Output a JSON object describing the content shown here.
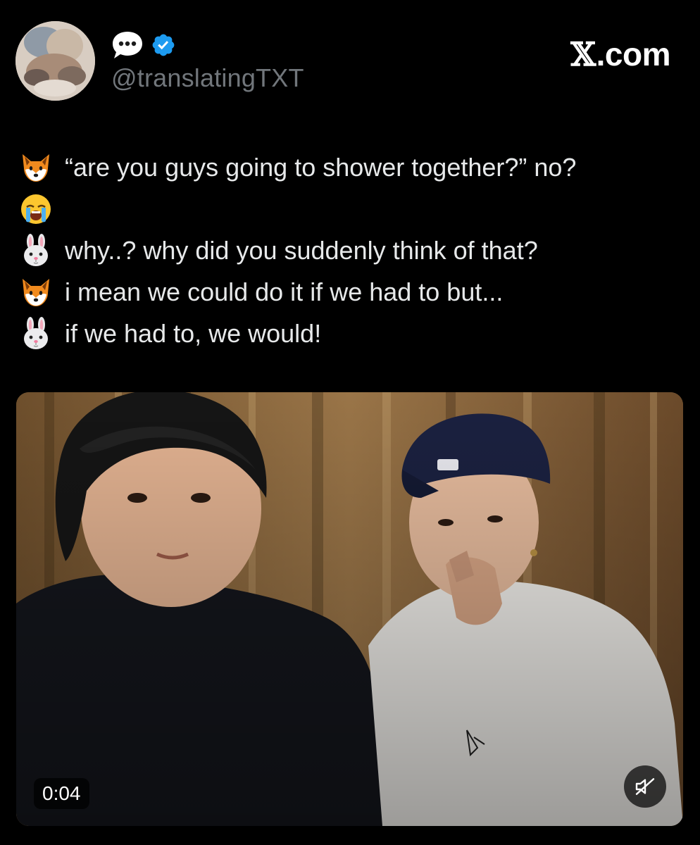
{
  "tweet": {
    "handle": "@translatingTXT",
    "brand": "X.com",
    "lines": [
      {
        "speaker_icon": "fox-emoji",
        "text": "“are you guys going to shower together?” no?"
      },
      {
        "speaker_icon": "crying-face-emoji",
        "text": ""
      },
      {
        "speaker_icon": "rabbit-emoji",
        "text": "why..? why did you suddenly think of that?"
      },
      {
        "speaker_icon": "fox-emoji",
        "text": "i mean we could do it if we had to but..."
      },
      {
        "speaker_icon": "rabbit-emoji",
        "text": "if we had to, we would!"
      }
    ]
  },
  "video": {
    "time": "0:04",
    "mute_icon": "muted-speaker-icon"
  },
  "colors": {
    "background": "#000000",
    "text": "#e7e9ea",
    "handle": "#71767b",
    "verified": "#1d9bf0"
  }
}
